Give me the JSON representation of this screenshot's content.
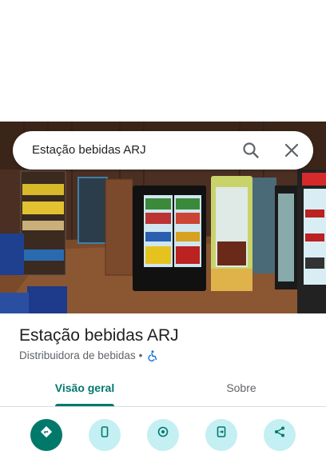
{
  "search": {
    "query": "Estação bebidas ARJ",
    "search_icon": "search-icon",
    "clear_icon": "close-icon"
  },
  "place": {
    "name": "Estação bebidas ARJ",
    "category": "Distribuidora de bebidas",
    "separator": "•",
    "accessibility_icon": "wheelchair-icon"
  },
  "tabs": [
    {
      "label": "Visão geral",
      "active": true
    },
    {
      "label": "Sobre",
      "active": false
    }
  ],
  "actions": [
    {
      "icon": "directions-icon",
      "primary": true
    },
    {
      "icon": "phone-icon",
      "primary": false
    },
    {
      "icon": "nearby-icon",
      "primary": false
    },
    {
      "icon": "send-to-phone-icon",
      "primary": false
    },
    {
      "icon": "share-icon",
      "primary": false
    }
  ],
  "colors": {
    "accent": "#00796b",
    "action_bg": "#c4eff3",
    "accessibility_blue": "#1a73e8"
  }
}
